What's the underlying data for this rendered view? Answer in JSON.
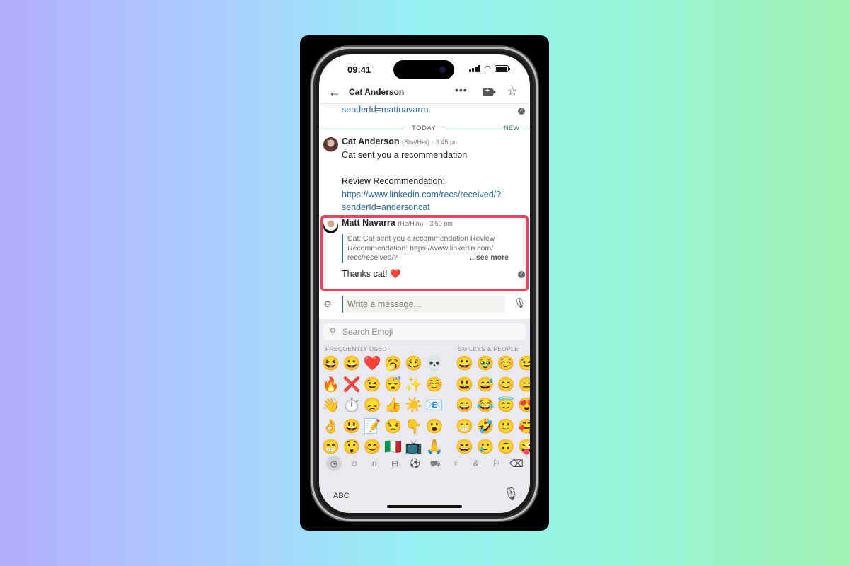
{
  "status_bar": {
    "time": "09:41"
  },
  "header": {
    "back_icon": "arrow-left-icon",
    "title": "Cat Anderson",
    "more_icon": "ellipsis-icon",
    "video_icon": "video-call-icon",
    "star_icon": "star-icon"
  },
  "conversation": {
    "previous_link_tail": "senderId=mattnavarra",
    "divider": {
      "label": "TODAY",
      "new_label": "NEW"
    },
    "messages": [
      {
        "sender": "Cat Anderson",
        "pronouns": "(She/Her)",
        "time": "3:45 pm",
        "lines": [
          "Cat sent you a recommendation",
          "",
          "Review Recommendation:"
        ],
        "link_line1": "https://www.linkedin.com/recs/received/?",
        "link_line2": "senderId=andersoncat"
      },
      {
        "sender": "Matt Navarra",
        "pronouns": "(He/Him)",
        "time": "3:50 pm",
        "quote_line1": "Cat: Cat sent you a recommendation  Review",
        "quote_line2": "Recommendation: https://www.linkedin.com/",
        "quote_line3": "recs/received/?",
        "see_more": "...see more",
        "text": "Thanks cat! ❤️",
        "highlighted": true,
        "highlight_color": "#e0485c"
      }
    ]
  },
  "composer": {
    "placeholder": "Write a message...",
    "attach_icon": "paperclip-icon",
    "mic_icon": "microphone-icon"
  },
  "emoji_keyboard": {
    "search_placeholder": "Search Emoji",
    "sections": [
      {
        "label": "FREQUENTLY USED",
        "emojis": [
          "😆",
          "😀",
          "❤️",
          "🥱",
          "🥴",
          "💀",
          "🔥",
          "❌",
          "😉",
          "😴",
          "✨",
          "☺️",
          "👋",
          "⏱️",
          "😞",
          "👍",
          "☀️",
          "📧",
          "👌",
          "😃",
          "📝",
          "😒",
          "👇",
          "😮",
          "😁",
          "😲",
          "😊",
          "🇮🇹",
          "📺",
          "🙏"
        ]
      },
      {
        "label": "SMILEYS & PEOPLE",
        "emojis": [
          "😀",
          "🥹",
          "☺️",
          "😉",
          "😃",
          "😅",
          "😊",
          "😑",
          "😄",
          "😂",
          "😇",
          "😍",
          "😁",
          "🤣",
          "🙂",
          "🥰",
          "😆",
          "🥲",
          "🙃",
          "😜"
        ]
      }
    ],
    "category_icons": [
      "recent-icon",
      "smiley-icon",
      "animal-icon",
      "food-icon",
      "activity-icon",
      "travel-icon",
      "objects-icon",
      "symbols-icon",
      "flag-icon"
    ],
    "category_glyphs": [
      "◷",
      "☺",
      "ʊ",
      "⊟",
      "⚽",
      "⛟",
      "♀",
      "&",
      "⚐"
    ],
    "delete_glyph": "⌫",
    "abc_label": "ABC"
  }
}
